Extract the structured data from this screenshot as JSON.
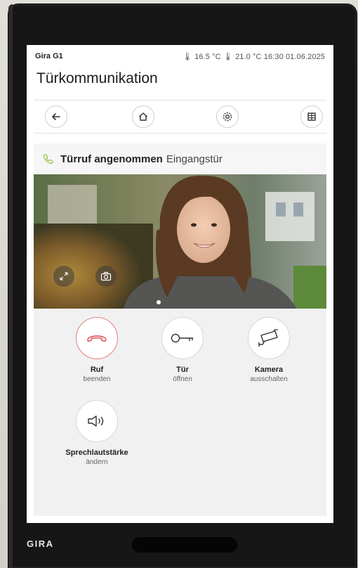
{
  "status": {
    "brand": "Gira G1",
    "right": "🌡 16.5 °C 🌡 21.0 °C 16:30 01.06.2025"
  },
  "page": {
    "title": "Türkommunikation"
  },
  "nav": {
    "back": "back-arrow-icon",
    "home": "home-icon",
    "settings": "settings-gear-icon",
    "grid": "grid-icon"
  },
  "call": {
    "status": "Türruf angenommen",
    "location": "Eingangstür"
  },
  "actions": [
    {
      "label": "Ruf",
      "sub": "beenden"
    },
    {
      "label": "Tür",
      "sub": "öffnen"
    },
    {
      "label": "Kamera",
      "sub": "ausschalten"
    },
    {
      "label": "Sprechlautstärke",
      "sub": "ändern"
    }
  ],
  "device": {
    "logo": "GIRA"
  },
  "colors": {
    "accent_green": "#9bc64a",
    "end_call_red": "#d94a4a"
  }
}
